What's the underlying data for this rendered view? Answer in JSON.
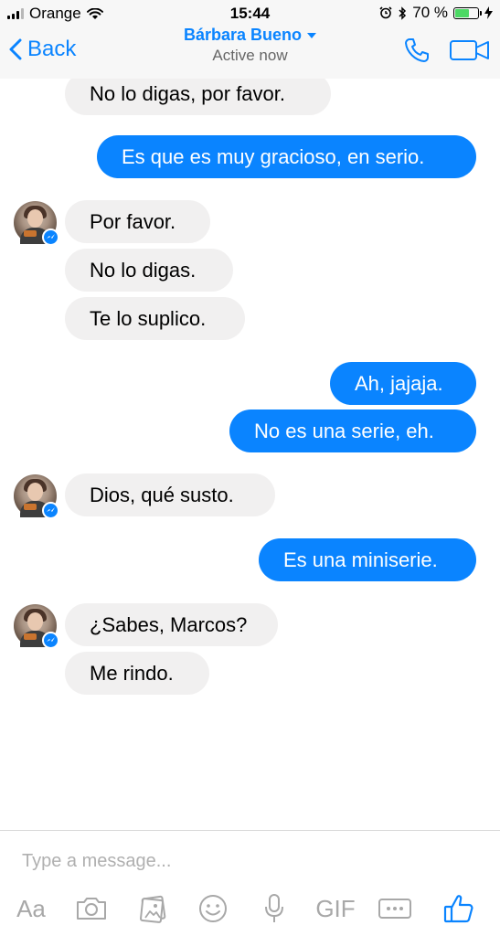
{
  "status_bar": {
    "carrier": "Orange",
    "time": "15:44",
    "battery_percent": "70 %",
    "battery_level": 0.7
  },
  "nav": {
    "back_label": "Back",
    "contact_name": "Bárbara Bueno",
    "status": "Active now",
    "accent_color": "#0a84ff"
  },
  "messages": [
    {
      "from": "them",
      "text": "No lo digas, por favor."
    },
    {
      "from": "me",
      "text": "Es que es muy gracioso, en serio."
    },
    {
      "from": "them",
      "text": "Por favor."
    },
    {
      "from": "them",
      "text": "No lo digas."
    },
    {
      "from": "them",
      "text": "Te lo suplico."
    },
    {
      "from": "me",
      "text": "Ah, jajaja."
    },
    {
      "from": "me",
      "text": "No es una serie, eh."
    },
    {
      "from": "them",
      "text": "Dios, qué susto."
    },
    {
      "from": "me",
      "text": "Es una miniserie."
    },
    {
      "from": "them",
      "text": "¿Sabes, Marcos?"
    },
    {
      "from": "them",
      "text": "Me rindo."
    }
  ],
  "composer": {
    "placeholder": "Type a message...",
    "text_tool_label": "Aa",
    "gif_label": "GIF",
    "icons": [
      "aa-text-icon",
      "camera-icon",
      "gallery-icon",
      "emoji-icon",
      "microphone-icon",
      "gif-icon",
      "more-icon",
      "thumbs-up-icon"
    ]
  }
}
